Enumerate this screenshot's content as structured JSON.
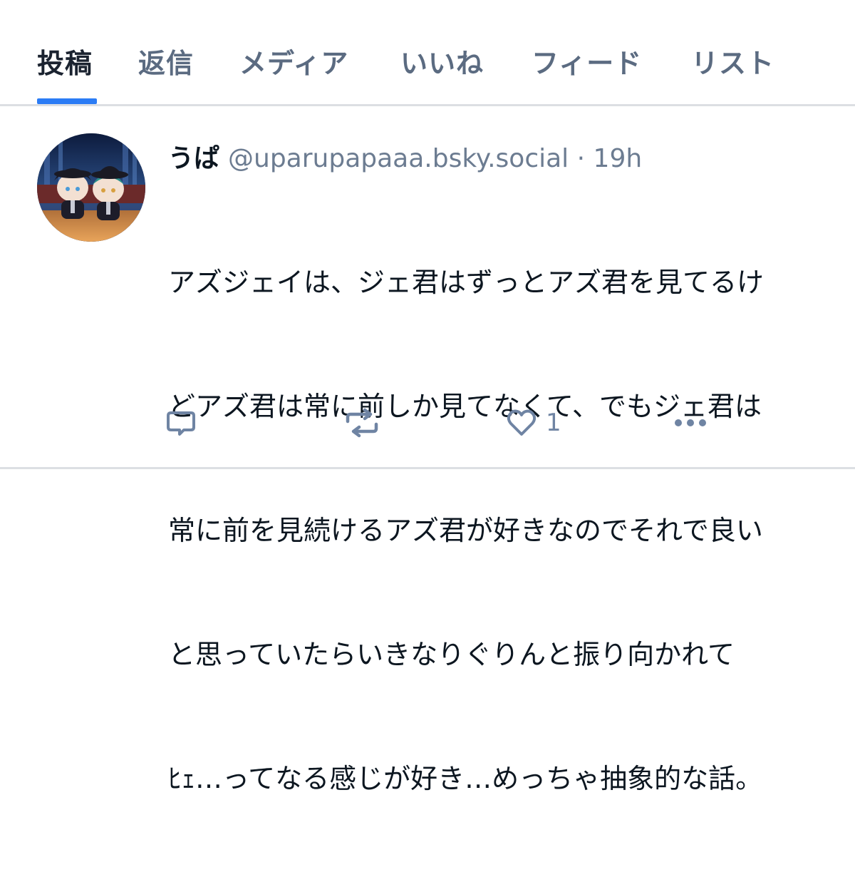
{
  "tabs": [
    {
      "label": "投稿",
      "active": true
    },
    {
      "label": "返信",
      "active": false
    },
    {
      "label": "メディア",
      "active": false
    },
    {
      "label": "いいね",
      "active": false
    },
    {
      "label": "フィード",
      "active": false
    },
    {
      "label": "リスト",
      "active": false
    }
  ],
  "post": {
    "display_name": "うぱ",
    "handle": "@uparupapaaa.bsky.social",
    "separator": "·",
    "time": "19h",
    "text_lines": [
      "アズジェイは、ジェ君はずっとアズ君を見てるけ",
      "どアズ君は常に前しか見てなくて、でもジェ君は",
      "常に前を見続けるアズ君が好きなのでそれで良い",
      "と思っていたらいきなりぐりんと振り向かれて",
      "ﾋｪ…ってなる感じが好き…めっちゃ抽象的な話。"
    ],
    "like_count": "1"
  },
  "actions": {
    "reply_icon": "speech-bubble-icon",
    "repost_icon": "repost-arrows-icon",
    "like_icon": "heart-icon",
    "more_icon": "ellipsis-icon"
  },
  "colors": {
    "accent": "#2b7cf5",
    "text_primary": "#0c1620",
    "text_secondary": "#6c7c91",
    "icon": "#6f84a3"
  }
}
